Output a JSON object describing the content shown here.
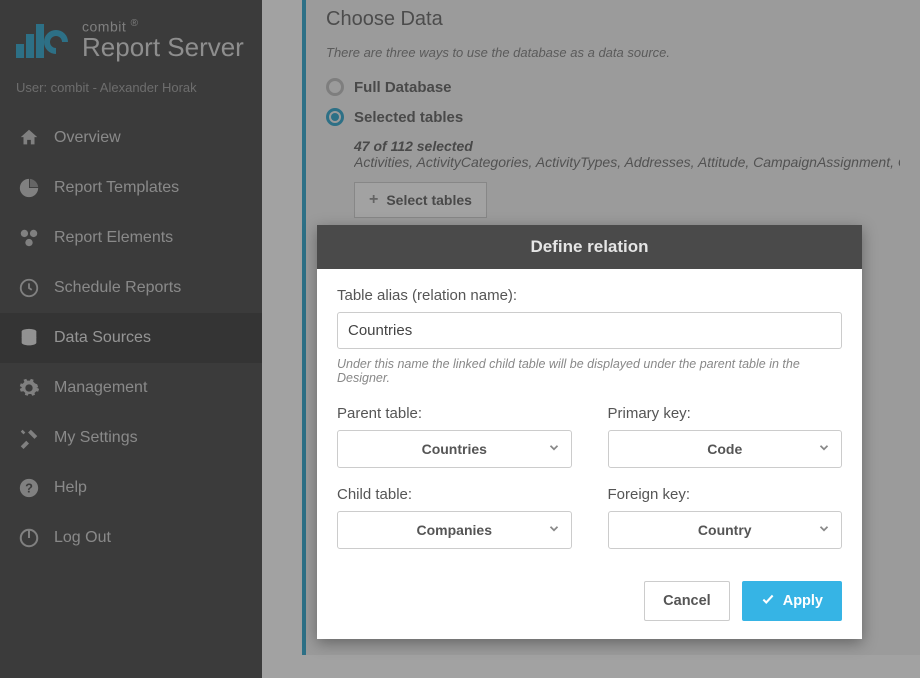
{
  "brand": {
    "company": "combit",
    "product": "Report Server",
    "registered": "®"
  },
  "user_line": "User: combit - Alexander Horak",
  "nav": {
    "overview": "Overview",
    "templates": "Report Templates",
    "elements": "Report Elements",
    "schedule": "Schedule Reports",
    "datasources": "Data Sources",
    "management": "Management",
    "settings": "My Settings",
    "help": "Help",
    "logout": "Log Out"
  },
  "panel": {
    "title": "Choose Data",
    "subtitle": "There are three ways to use the database as a data source.",
    "option_full": "Full Database",
    "option_selected": "Selected tables",
    "selected_count": "47 of 112 selected",
    "selected_list": "Activities, ActivityCategories, ActivityTypes, Addresses, Attitude, CampaignAssignment, Cam",
    "select_tables_btn": "Select tables"
  },
  "dialog": {
    "title": "Define relation",
    "alias_label": "Table alias (relation name):",
    "alias_value": "Countries",
    "alias_hint": "Under this name the linked child table will be displayed under the parent table in the Designer.",
    "parent_table_label": "Parent table:",
    "parent_table_value": "Countries",
    "primary_key_label": "Primary key:",
    "primary_key_value": "Code",
    "child_table_label": "Child table:",
    "child_table_value": "Companies",
    "foreign_key_label": "Foreign key:",
    "foreign_key_value": "Country",
    "cancel": "Cancel",
    "apply": "Apply"
  }
}
